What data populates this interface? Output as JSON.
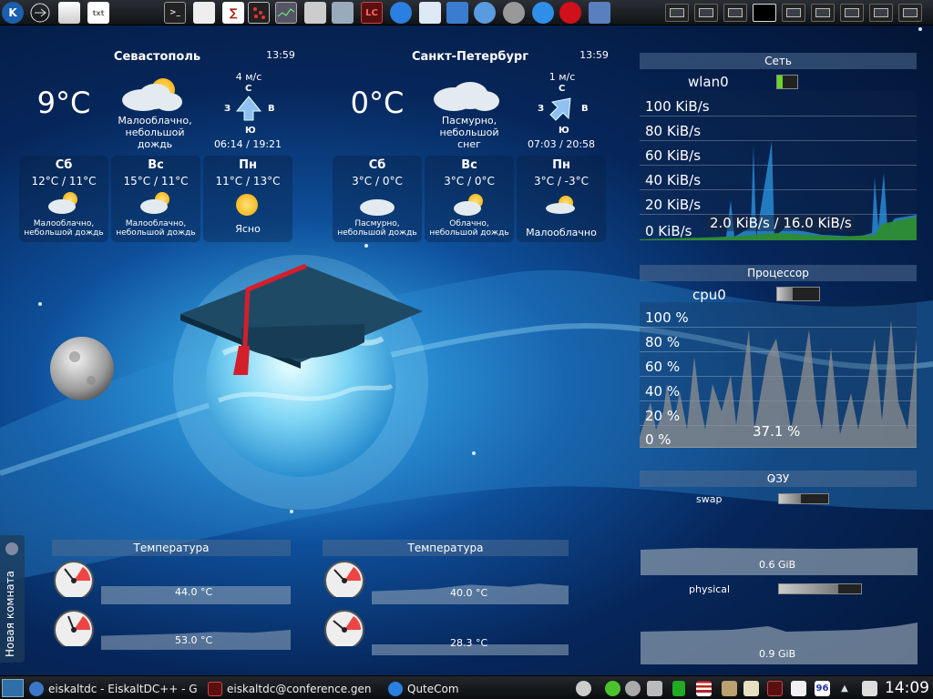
{
  "weather": [
    {
      "city": "Севастополь",
      "time": "13:59",
      "temp": "9°C",
      "condition": [
        "Малооблачно,",
        "небольшой",
        "дождь"
      ],
      "wind_speed": "4 м/с",
      "dir_n": "С",
      "dir_w": "З",
      "dir_e": "В",
      "dir_s": "Ю",
      "sun": "06:14 / 19:21",
      "forecast": [
        {
          "day": "Сб",
          "range": "12°C / 11°C",
          "cond": [
            "Малооблачно,",
            "небольшой дождь"
          ]
        },
        {
          "day": "Вс",
          "range": "15°C / 11°C",
          "cond": [
            "Малооблачно,",
            "небольшой дождь"
          ]
        },
        {
          "day": "Пн",
          "range": "11°C / 13°C",
          "cond": [
            "Ясно",
            ""
          ]
        }
      ]
    },
    {
      "city": "Санкт-Петербург",
      "time": "13:59",
      "temp": "0°C",
      "condition": [
        "Пасмурно,",
        "небольшой",
        "снег"
      ],
      "wind_speed": "1 м/с",
      "dir_n": "С",
      "dir_w": "З",
      "dir_e": "В",
      "dir_s": "Ю",
      "sun": "07:03 / 20:58",
      "forecast": [
        {
          "day": "Сб",
          "range": "3°C / 0°C",
          "cond": [
            "Пасмурно,",
            "небольшой дождь"
          ]
        },
        {
          "day": "Вс",
          "range": "3°C / 0°C",
          "cond": [
            "Облачно,",
            "небольшой дождь"
          ]
        },
        {
          "day": "Пн",
          "range": "3°C / -3°C",
          "cond": [
            "Малооблачно",
            ""
          ]
        }
      ]
    }
  ],
  "network": {
    "title": "Сеть",
    "iface": "wlan0",
    "iface_level": 0.25,
    "levels": [
      "100 KiB/s",
      "80 KiB/s",
      "60 KiB/s",
      "40 KiB/s",
      "20 KiB/s",
      "0 KiB/s"
    ],
    "rate": "2.0 KiB/s / 16.0 KiB/s"
  },
  "cpu": {
    "title": "Процессор",
    "core": "cpu0",
    "core_level": 0.37,
    "levels": [
      "100 %",
      "80 %",
      "60 %",
      "40 %",
      "20 %",
      "0 %"
    ],
    "usage": "37.1 %"
  },
  "ram": {
    "title": "ОЗУ",
    "swap": "swap",
    "swap_level": 0.45,
    "swap_value": "0.6 GiB",
    "physical": "physical",
    "physical_level": 0.72,
    "physical_value": "0.9 GiB"
  },
  "temps": [
    {
      "title": "Температура",
      "values": [
        "44.0 °C",
        "53.0 °C"
      ]
    },
    {
      "title": "Температура",
      "values": [
        "40.0 °C",
        "28.3 °C"
      ]
    }
  ],
  "side_panel": {
    "label": "Новая комната"
  },
  "taskbar": {
    "tasks": [
      "eiskaltdc - EiskaltDC++ - G",
      "eiskaltdc@conference.gen",
      "QuteCom"
    ],
    "tray_badge": "96",
    "clock": "14:09"
  },
  "launcher": {
    "txt_icon": "txt",
    "lc_icon": "LC"
  },
  "colors": {
    "accent": "#1f8ff0",
    "cpu_fill": "#8f8f8f",
    "net_fill": "#2e8b2e"
  }
}
